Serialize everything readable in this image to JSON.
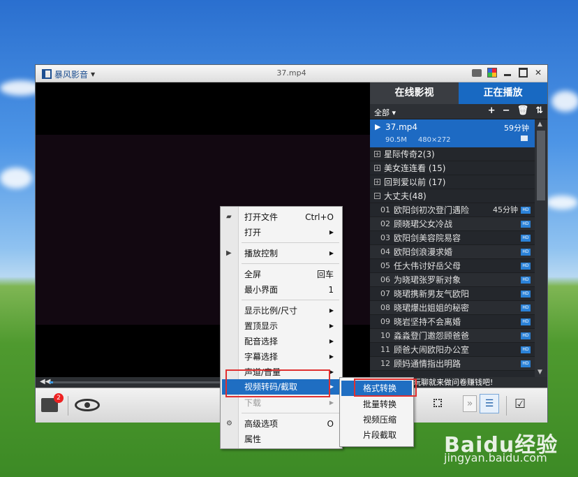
{
  "window": {
    "app_name": "暴风影音",
    "file_title": "37.mp4"
  },
  "playlist": {
    "tab_online": "在线影视",
    "tab_playing": "正在播放",
    "filter_label": "全部",
    "current": {
      "title": "37.mp4",
      "duration": "59分钟",
      "size": "90.5M",
      "resolution": "480×272"
    },
    "groups": [
      {
        "label": "星际传奇2(3)"
      },
      {
        "label": "美女连连看 (15)"
      },
      {
        "label": "回到爱以前 (17)"
      },
      {
        "label": "大丈夫(48)"
      }
    ],
    "items": [
      {
        "num": "01",
        "name": "欧阳剑初次登门遇险",
        "duration": "45分钟",
        "badge": "HD"
      },
      {
        "num": "02",
        "name": "顾晓珺父女冷战",
        "duration": "",
        "badge": "HD"
      },
      {
        "num": "03",
        "name": "欧阳剑美容院易容",
        "duration": "",
        "badge": "HD"
      },
      {
        "num": "04",
        "name": "欧阳剑浪漫求婚",
        "duration": "",
        "badge": "HD"
      },
      {
        "num": "05",
        "name": "任大伟讨好岳父母",
        "duration": "",
        "badge": "HD"
      },
      {
        "num": "06",
        "name": "为晓珺张罗新对象",
        "duration": "",
        "badge": "HD"
      },
      {
        "num": "07",
        "name": "晓珺携新男友气欧阳",
        "duration": "",
        "badge": "HD"
      },
      {
        "num": "08",
        "name": "晓珺爆出姐姐的秘密",
        "duration": "",
        "badge": "HD"
      },
      {
        "num": "09",
        "name": "晓岩坚持不会离婚",
        "duration": "",
        "badge": "HD"
      },
      {
        "num": "10",
        "name": "淼淼登门邀怨顾爸爸",
        "duration": "",
        "badge": "HD"
      },
      {
        "num": "11",
        "name": "顾爸大闹欧阳办公室",
        "duration": "",
        "badge": "HD"
      },
      {
        "num": "12",
        "name": "顾妈通情指出明路",
        "duration": "",
        "badge": "HD"
      }
    ],
    "ad_text": "玩聊就来做问卷赚钱吧!"
  },
  "seek": {
    "progress_percent": 1
  },
  "bottom": {
    "badge_count": "2"
  },
  "context_menu": {
    "open_file": "打开文件",
    "open_file_shortcut": "Ctrl+O",
    "open": "打开",
    "playback_control": "播放控制",
    "fullscreen": "全屏",
    "fullscreen_shortcut": "回车",
    "mini_mode": "最小界面",
    "mini_mode_shortcut": "1",
    "aspect_ratio": "显示比例/尺寸",
    "on_top": "置顶显示",
    "dubbing": "配音选择",
    "subtitle": "字幕选择",
    "audio_volume": "声道/音量",
    "transcode": "视频转码/截取",
    "download": "下载",
    "advanced": "高级选项",
    "advanced_shortcut": "O",
    "properties": "属性"
  },
  "submenu": {
    "format_convert": "格式转换",
    "batch_convert": "批量转换",
    "video_compress": "视频压缩",
    "clip_capture": "片段截取"
  },
  "watermark": {
    "logo": "Baidu经验",
    "url": "jingyan.baidu.com"
  }
}
